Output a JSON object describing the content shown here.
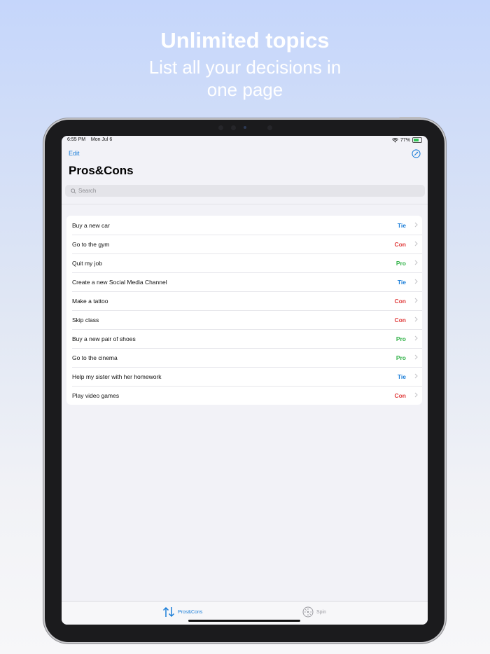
{
  "promo": {
    "title": "Unlimited topics",
    "subtitle_line1": "List all your decisions in",
    "subtitle_line2": "one page"
  },
  "status_bar": {
    "time": "6:55 PM",
    "date": "Mon Jul 6",
    "battery": "77%",
    "wifi_icon": "wifi-icon",
    "battery_icon": "battery-icon"
  },
  "nav": {
    "edit_label": "Edit",
    "compose_icon": "compose-icon",
    "title": "Pros&Cons"
  },
  "search": {
    "placeholder": "Search",
    "value": ""
  },
  "colors": {
    "accent": "#1b7ed8",
    "tie": "#1b7ed8",
    "con": "#e03d3d",
    "pro": "#34b34a"
  },
  "items": [
    {
      "label": "Buy a new car",
      "result": "Tie"
    },
    {
      "label": "Go to the gym",
      "result": "Con"
    },
    {
      "label": "Quit my job",
      "result": "Pro"
    },
    {
      "label": "Create a new Social Media Channel",
      "result": "Tie"
    },
    {
      "label": "Make a tattoo",
      "result": "Con"
    },
    {
      "label": "Skip class",
      "result": "Con"
    },
    {
      "label": "Buy a new pair of shoes",
      "result": "Pro"
    },
    {
      "label": "Go to the cinema",
      "result": "Pro"
    },
    {
      "label": "Help my sister with her homework",
      "result": "Tie"
    },
    {
      "label": "Play video games",
      "result": "Con"
    }
  ],
  "tabs": [
    {
      "label": "Pros&Cons",
      "icon": "sort-arrows-icon",
      "selected": true
    },
    {
      "label": "Spin",
      "icon": "spin-wheel-icon",
      "selected": false
    }
  ]
}
